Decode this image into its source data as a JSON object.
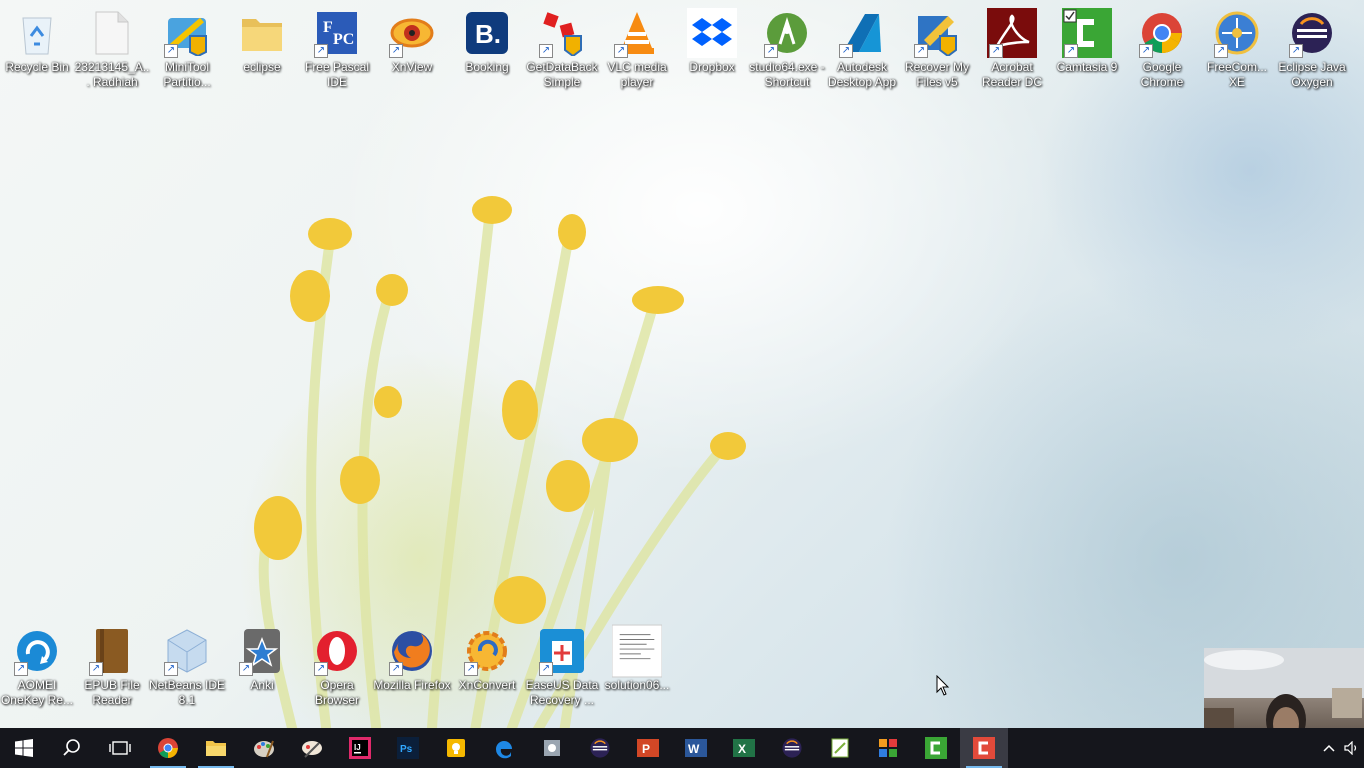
{
  "desktop_icons_top": [
    {
      "label": "Recycle Bin",
      "icon": "recycle-bin-icon",
      "shortcut": false
    },
    {
      "label": "23213145_A... Radhiah",
      "icon": "document-file-icon",
      "shortcut": false
    },
    {
      "label": "MiniTool Partitio...",
      "icon": "minitool-icon",
      "shortcut": true
    },
    {
      "label": "eclipse",
      "icon": "folder-icon",
      "shortcut": false
    },
    {
      "label": "Free Pascal IDE",
      "icon": "free-pascal-icon",
      "shortcut": true
    },
    {
      "label": "XnView",
      "icon": "xnview-icon",
      "shortcut": true
    },
    {
      "label": "Booking",
      "icon": "booking-icon",
      "shortcut": false
    },
    {
      "label": "GetDataBack Simple",
      "icon": "getdataback-icon",
      "shortcut": true
    },
    {
      "label": "VLC media player",
      "icon": "vlc-icon",
      "shortcut": true
    },
    {
      "label": "Dropbox",
      "icon": "dropbox-icon",
      "shortcut": false
    },
    {
      "label": "studio64.exe - Shortcut",
      "icon": "android-studio-icon",
      "shortcut": true
    },
    {
      "label": "Autodesk Desktop App",
      "icon": "autodesk-icon",
      "shortcut": true
    },
    {
      "label": "Recover My Files v5",
      "icon": "recover-my-files-icon",
      "shortcut": true
    },
    {
      "label": "Acrobat Reader DC",
      "icon": "acrobat-icon",
      "shortcut": true
    },
    {
      "label": "Camtasia 9",
      "icon": "camtasia-icon",
      "shortcut": true
    },
    {
      "label": "Google Chrome",
      "icon": "chrome-icon",
      "shortcut": true
    },
    {
      "label": "FreeCom... XE",
      "icon": "freecommander-icon",
      "shortcut": true
    },
    {
      "label": "Eclipse Java Oxygen",
      "icon": "eclipse-icon",
      "shortcut": true
    }
  ],
  "desktop_icons_bottom": [
    {
      "label": "AOMEI OneKey Re...",
      "icon": "aomei-icon",
      "shortcut": true
    },
    {
      "label": "EPUB File Reader",
      "icon": "epub-reader-icon",
      "shortcut": true
    },
    {
      "label": "NetBeans IDE 8.1",
      "icon": "netbeans-icon",
      "shortcut": true
    },
    {
      "label": "Anki",
      "icon": "anki-icon",
      "shortcut": true
    },
    {
      "label": "Opera Browser",
      "icon": "opera-icon",
      "shortcut": true
    },
    {
      "label": "Mozilla Firefox",
      "icon": "firefox-icon",
      "shortcut": true
    },
    {
      "label": "XnConvert",
      "icon": "xnconvert-icon",
      "shortcut": true
    },
    {
      "label": "EaseUS Data Recovery ...",
      "icon": "easeus-icon",
      "shortcut": true
    },
    {
      "label": "solution06...",
      "icon": "document-thumbnail-icon",
      "shortcut": false
    }
  ],
  "taskbar": {
    "start": "windows-start-icon",
    "search": "search-icon",
    "task_view": "task-view-icon",
    "apps": [
      {
        "icon": "chrome-icon",
        "active": true
      },
      {
        "icon": "file-explorer-icon",
        "active": true
      },
      {
        "icon": "paint-icon",
        "active": false
      },
      {
        "icon": "paintbrush-icon",
        "active": false
      },
      {
        "icon": "intellij-icon",
        "active": false
      },
      {
        "icon": "photoshop-icon",
        "active": false
      },
      {
        "icon": "tips-bulb-icon",
        "active": false
      },
      {
        "icon": "edge-icon",
        "active": false
      },
      {
        "icon": "system-settings-icon",
        "active": false
      },
      {
        "icon": "eclipse-icon",
        "active": false
      },
      {
        "icon": "powerpoint-icon",
        "active": false
      },
      {
        "icon": "word-icon",
        "active": false
      },
      {
        "icon": "excel-icon",
        "active": false
      },
      {
        "icon": "eclipse-icon",
        "active": false
      },
      {
        "icon": "notepad-plus-icon",
        "active": false
      },
      {
        "icon": "archive-tool-icon",
        "active": false
      },
      {
        "icon": "camtasia-icon",
        "active": false
      },
      {
        "icon": "camtasia-recorder-icon",
        "active": true,
        "focused": true
      }
    ],
    "tray": [
      "chevron-up-icon",
      "volume-icon"
    ]
  },
  "colors": {
    "taskbar_bg": "#15161c",
    "active_indicator": "#76b9ed"
  }
}
